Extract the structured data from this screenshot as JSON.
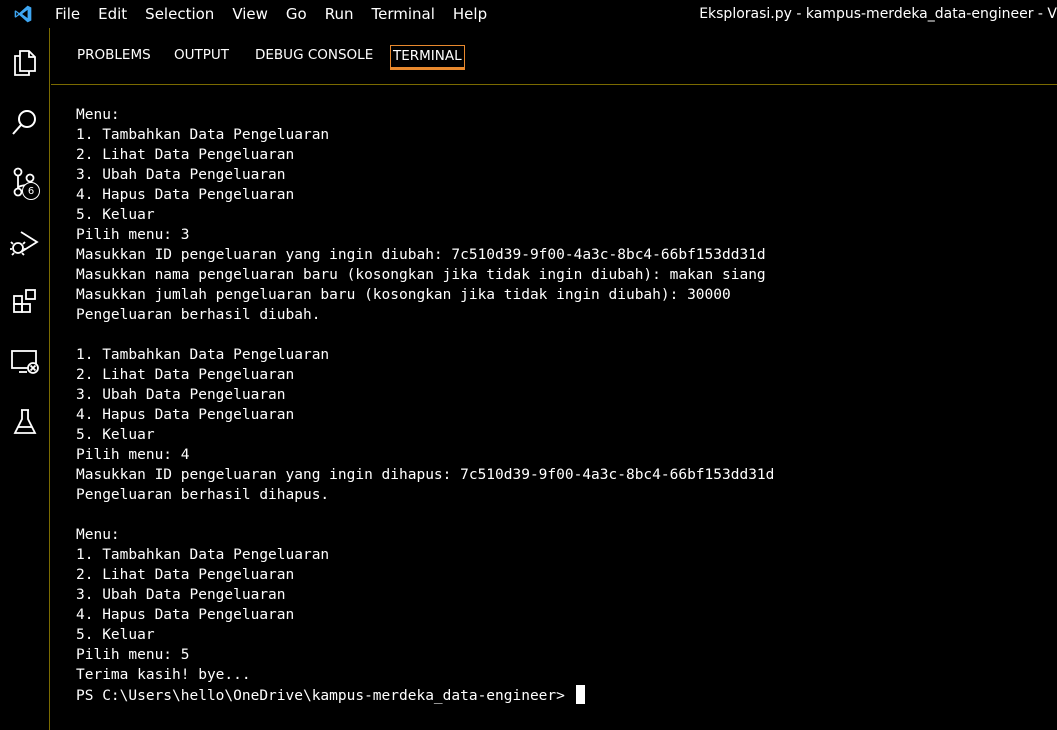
{
  "menubar": {
    "items": [
      "File",
      "Edit",
      "Selection",
      "View",
      "Go",
      "Run",
      "Terminal",
      "Help"
    ],
    "window_title": "Eksplorasi.py - kampus-merdeka_data-engineer - V"
  },
  "activity_bar": {
    "icons": [
      "explorer-icon",
      "search-icon",
      "source-control-icon",
      "run-debug-icon",
      "extensions-icon",
      "remote-explorer-icon",
      "testing-icon"
    ],
    "source_control_badge": "6"
  },
  "panel": {
    "tabs": [
      "PROBLEMS",
      "OUTPUT",
      "DEBUG CONSOLE",
      "TERMINAL"
    ],
    "active_tab": "TERMINAL"
  },
  "terminal": {
    "lines": [
      "Menu:",
      "1. Tambahkan Data Pengeluaran",
      "2. Lihat Data Pengeluaran",
      "3. Ubah Data Pengeluaran",
      "4. Hapus Data Pengeluaran",
      "5. Keluar",
      "Pilih menu: 3",
      "Masukkan ID pengeluaran yang ingin diubah: 7c510d39-9f00-4a3c-8bc4-66bf153dd31d",
      "Masukkan nama pengeluaran baru (kosongkan jika tidak ingin diubah): makan siang",
      "Masukkan jumlah pengeluaran baru (kosongkan jika tidak ingin diubah): 30000",
      "Pengeluaran berhasil diubah.",
      "",
      "1. Tambahkan Data Pengeluaran",
      "2. Lihat Data Pengeluaran",
      "3. Ubah Data Pengeluaran",
      "4. Hapus Data Pengeluaran",
      "5. Keluar",
      "Pilih menu: 4",
      "Masukkan ID pengeluaran yang ingin dihapus: 7c510d39-9f00-4a3c-8bc4-66bf153dd31d",
      "Pengeluaran berhasil dihapus.",
      "",
      "Menu:",
      "1. Tambahkan Data Pengeluaran",
      "2. Lihat Data Pengeluaran",
      "3. Ubah Data Pengeluaran",
      "4. Hapus Data Pengeluaran",
      "5. Keluar",
      "Pilih menu: 5",
      "Terima kasih! bye...",
      "PS C:\\Users\\hello\\OneDrive\\kampus-merdeka_data-engineer> "
    ]
  }
}
